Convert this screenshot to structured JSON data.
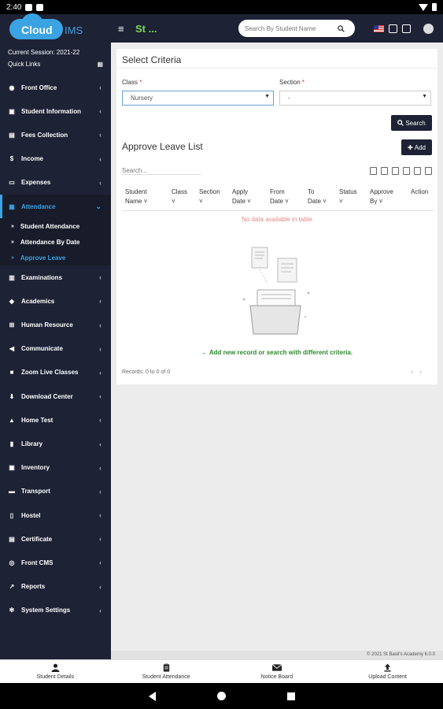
{
  "status_bar": {
    "time": "2:40"
  },
  "header": {
    "logo_text": "Cloud",
    "logo_suffix": "IMS",
    "menu_icon": "hamburger-icon",
    "school_name": "St ...",
    "search_placeholder": "Search By Student Name",
    "icons": [
      "flag-icon",
      "calendar-icon",
      "checklist-icon",
      "user-avatar-icon"
    ]
  },
  "sidebar": {
    "session_label": "Current Session: 2021-22",
    "quick_links_label": "Quick Links",
    "items": [
      {
        "label": "Front Office",
        "icon": "building-icon"
      },
      {
        "label": "Student Information",
        "icon": "user-id-icon"
      },
      {
        "label": "Fees Collection",
        "icon": "money-icon"
      },
      {
        "label": "Income",
        "icon": "dollar-icon"
      },
      {
        "label": "Expenses",
        "icon": "credit-card-icon"
      },
      {
        "label": "Attendance",
        "icon": "calendar-icon"
      },
      {
        "label": "Examinations",
        "icon": "map-icon"
      },
      {
        "label": "Academics",
        "icon": "graduation-cap-icon"
      },
      {
        "label": "Human Resource",
        "icon": "sitemap-icon"
      },
      {
        "label": "Communicate",
        "icon": "bullhorn-icon"
      },
      {
        "label": "Zoom Live Classes",
        "icon": "video-icon"
      },
      {
        "label": "Download Center",
        "icon": "download-icon"
      },
      {
        "label": "Home Test",
        "icon": "flask-icon"
      },
      {
        "label": "Library",
        "icon": "book-icon"
      },
      {
        "label": "Inventory",
        "icon": "inventory-icon"
      },
      {
        "label": "Transport",
        "icon": "bus-icon"
      },
      {
        "label": "Hostel",
        "icon": "hostel-icon"
      },
      {
        "label": "Certificate",
        "icon": "certificate-icon"
      },
      {
        "label": "Front CMS",
        "icon": "globe-icon"
      },
      {
        "label": "Reports",
        "icon": "line-chart-icon"
      },
      {
        "label": "System Settings",
        "icon": "gears-icon"
      }
    ],
    "attendance_sub": [
      "Student Attendance",
      "Attendance By Date",
      "Approve Leave"
    ]
  },
  "criteria": {
    "title": "Select Criteria",
    "class_label": "Class",
    "class_value": "Nursery",
    "section_label": "Section",
    "section_value": "-",
    "search_button": "Search",
    "required_mark": "*"
  },
  "leave_list": {
    "title": "Approve Leave List",
    "add_button": "Add",
    "search_placeholder": "Search...",
    "columns": [
      {
        "line1": "Student",
        "line2": "Name"
      },
      {
        "line1": "Class",
        "line2": ""
      },
      {
        "line1": "Section",
        "line2": ""
      },
      {
        "line1": "Apply",
        "line2": "Date"
      },
      {
        "line1": "From",
        "line2": "Date"
      },
      {
        "line1": "To",
        "line2": "Date"
      },
      {
        "line1": "Status",
        "line2": ""
      },
      {
        "line1": "Approve",
        "line2": "By"
      },
      {
        "line1": "Action",
        "line2": ""
      }
    ],
    "no_data": "No data available in table",
    "empty_message": "Add new record or search with different criteria.",
    "records": "Records: 0 to 0 of 0"
  },
  "footer": {
    "copyright": "© 2021 St Basil's Academy 6.0.0"
  },
  "bottom_nav": [
    "Student Details",
    "Student Attendance",
    "Notice Board",
    "Upload Content"
  ]
}
